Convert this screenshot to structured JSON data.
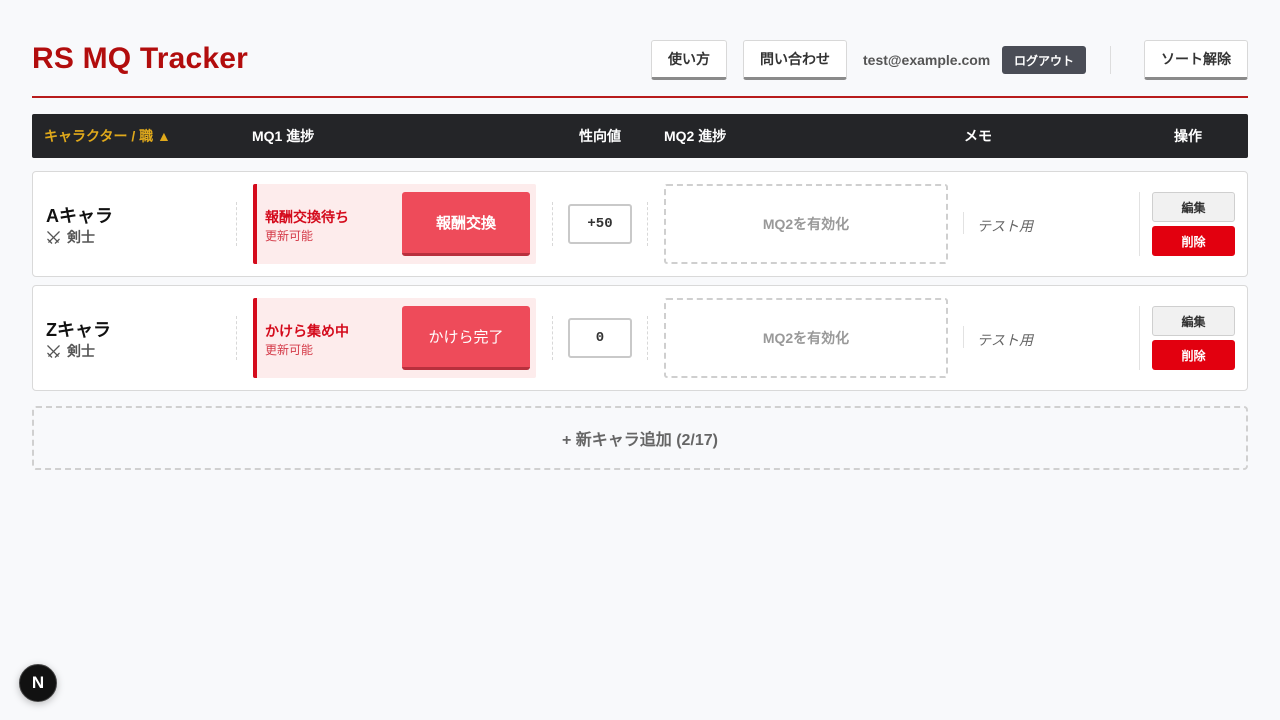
{
  "header": {
    "title": "RS MQ Tracker",
    "usage_label": "使い方",
    "contact_label": "問い合わせ",
    "email": "test@example.com",
    "logout_label": "ログアウト",
    "sort_reset_label": "ソート解除"
  },
  "table": {
    "columns": {
      "character": "キャラクター / 職 ▲",
      "mq1": "MQ1 進捗",
      "alignment": "性向値",
      "mq2": "MQ2 進捗",
      "memo": "メモ",
      "actions": "操作"
    },
    "rows": [
      {
        "name": "Aキャラ",
        "job_icon": "crossed-swords-icon",
        "job": "剣士",
        "mq1_status": "報酬交換待ち",
        "mq1_sub": "更新可能",
        "mq1_button": "報酬交換",
        "alignment": "+50",
        "mq2_label": "MQ2を有効化",
        "memo": "テスト用",
        "edit_label": "編集",
        "delete_label": "削除"
      },
      {
        "name": "Zキャラ",
        "job_icon": "crossed-swords-icon",
        "job": "剣士",
        "mq1_status": "かけら集め中",
        "mq1_sub": "更新可能",
        "mq1_button": "かけら完了",
        "alignment": "0",
        "mq2_label": "MQ2を有効化",
        "memo": "テスト用",
        "edit_label": "編集",
        "delete_label": "削除"
      }
    ]
  },
  "add_character_label": "+ 新キャラ追加 (2/17)",
  "badge": {
    "letter": "N",
    "icon": "nextjs-icon"
  },
  "colors": {
    "brand_red": "#b20d0d",
    "header_bg": "#242528",
    "sort_accent": "#e0a91b",
    "delete_red": "#e2000f",
    "mq1_button": "#ee4b5a"
  }
}
